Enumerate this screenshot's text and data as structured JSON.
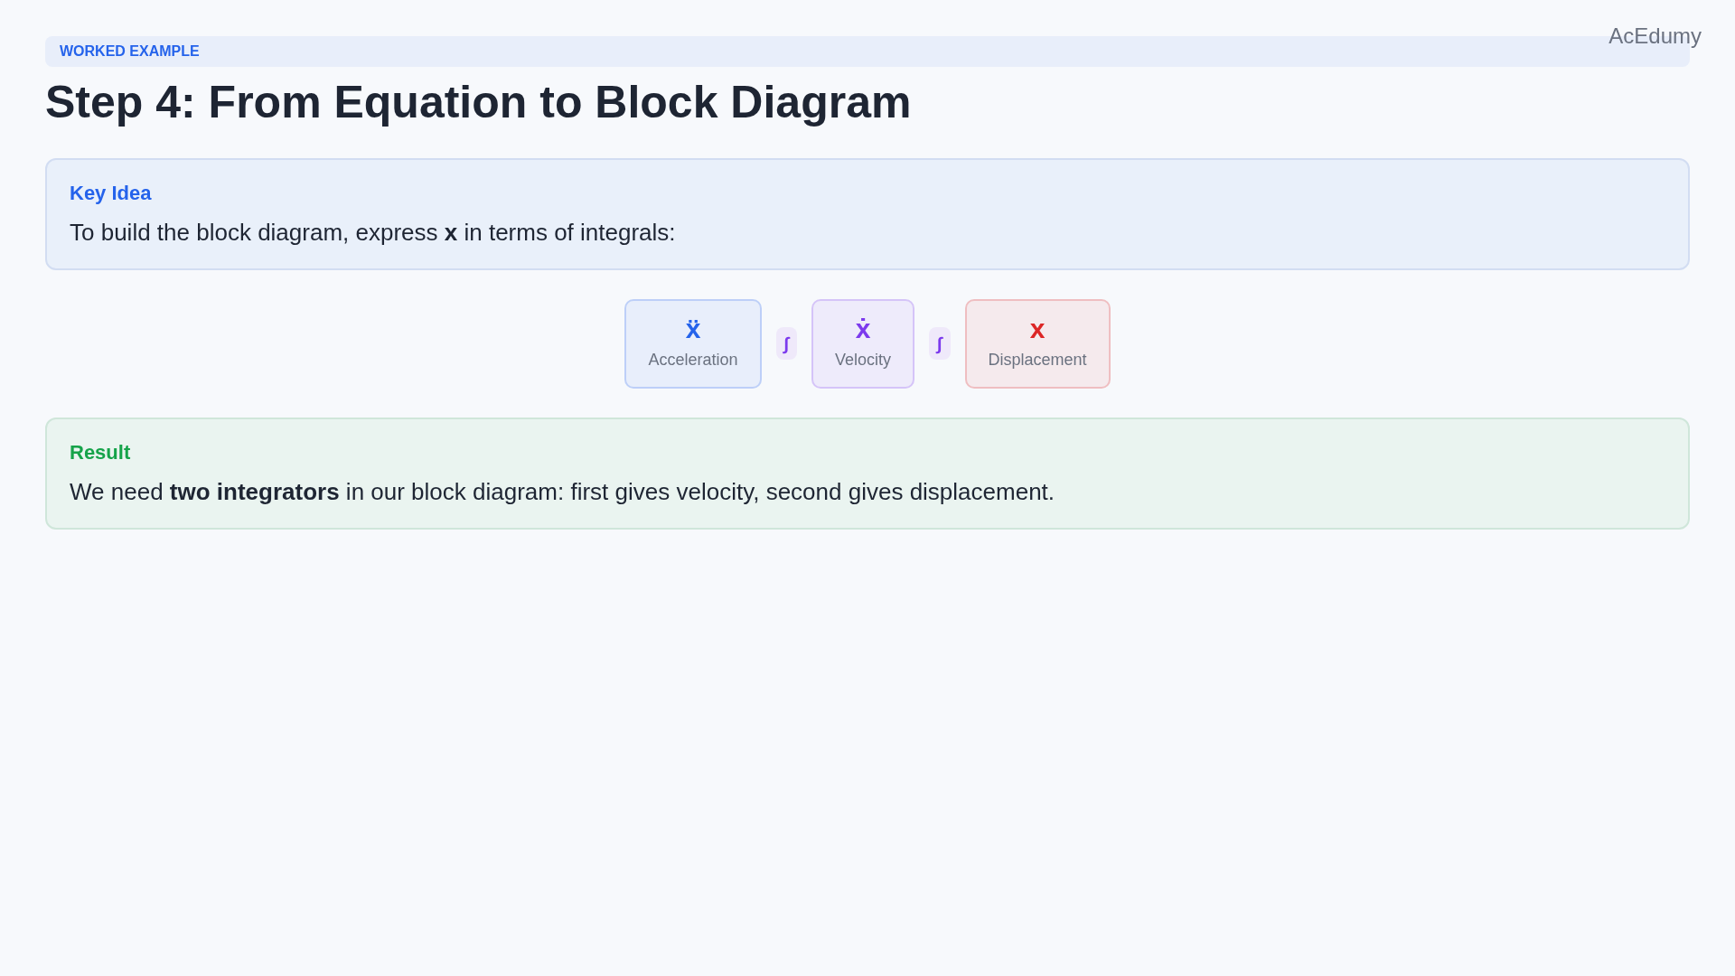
{
  "brand": "AcEdumy",
  "badge": "WORKED EXAMPLE",
  "title": "Step 4: From Equation to Block Diagram",
  "key_idea": {
    "heading": "Key Idea",
    "text": "To build the block diagram, express **x** in terms of integrals:"
  },
  "diagram": [
    {
      "kind": "block",
      "symbol": "ẍ",
      "label": "Acceleration",
      "color": "#2563eb"
    },
    {
      "kind": "operator",
      "symbol": "∫"
    },
    {
      "kind": "block",
      "symbol": "ẋ",
      "label": "Velocity",
      "color": "#7c3aed"
    },
    {
      "kind": "operator",
      "symbol": "∫"
    },
    {
      "kind": "block",
      "symbol": "x",
      "label": "Displacement",
      "color": "#dc2626"
    }
  ],
  "result": {
    "heading": "Result",
    "text": "We need **two integrators** in our block diagram: first gives velocity, second gives displacement."
  }
}
